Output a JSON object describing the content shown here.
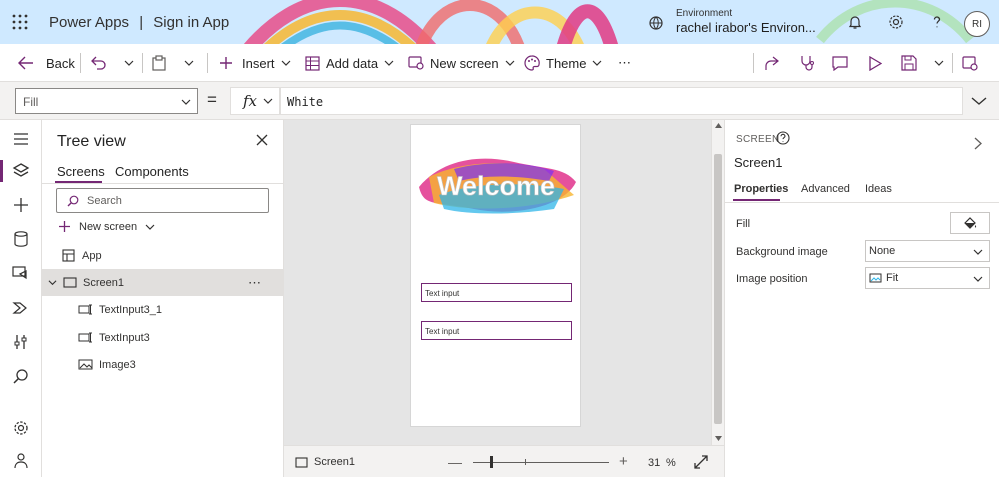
{
  "header": {
    "app_name": "Power Apps",
    "separator": "|",
    "app_title": "Sign in App",
    "environment_label": "Environment",
    "environment_name": "rachel irabor's Environ...",
    "avatar_initials": "RI"
  },
  "toolbar": {
    "back": "Back",
    "insert": "Insert",
    "add_data": "Add data",
    "new_screen": "New screen",
    "theme": "Theme",
    "more": "⋯"
  },
  "formula_bar": {
    "property": "Fill",
    "equals": "=",
    "fx": "fx",
    "formula": "White"
  },
  "tree_view": {
    "title": "Tree view",
    "tabs": [
      "Screens",
      "Components"
    ],
    "search_placeholder": "Search",
    "new_screen": "New screen",
    "items": [
      "App",
      "Screen1",
      "TextInput3_1",
      "TextInput3",
      "Image3"
    ],
    "more": "⋯"
  },
  "canvas": {
    "welcome_text": "Welcome",
    "text_inputs": [
      "Text input",
      "Text input"
    ]
  },
  "status_bar": {
    "screen_name": "Screen1",
    "minus": "—",
    "plus": "+",
    "zoom_value": "31",
    "zoom_unit": "%"
  },
  "properties": {
    "kind": "SCREEN",
    "name": "Screen1",
    "tabs": [
      "Properties",
      "Advanced",
      "Ideas"
    ],
    "fill_label": "Fill",
    "background_image_label": "Background image",
    "background_image_value": "None",
    "image_position_label": "Image position",
    "image_position_value": "Fit"
  },
  "colors": {
    "accent": "#742774",
    "header_bg": "#cfe9ff"
  }
}
